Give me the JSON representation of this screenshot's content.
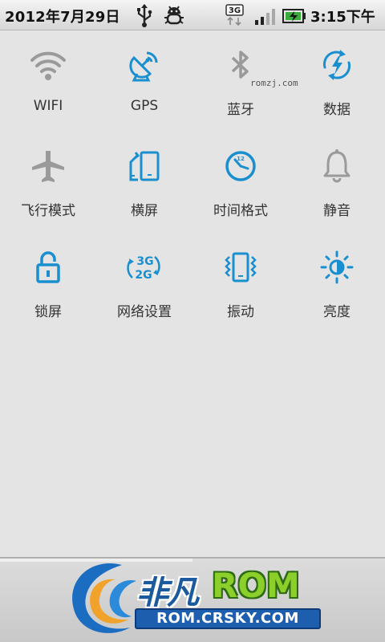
{
  "status_bar": {
    "date": "2012年7月29日",
    "network_type": "3G",
    "time": "3:15下午",
    "icons": [
      "usb-icon",
      "debug-icon",
      "3g-icon",
      "signal-icon",
      "battery-charging-icon"
    ]
  },
  "watermark": "romzj.com",
  "toggles": [
    {
      "label": "WIFI",
      "icon": "wifi-icon",
      "active": false
    },
    {
      "label": "GPS",
      "icon": "gps-icon",
      "active": true
    },
    {
      "label": "蓝牙",
      "icon": "bluetooth-icon",
      "active": false
    },
    {
      "label": "数据",
      "icon": "mobile-data-icon",
      "active": true
    },
    {
      "label": "飞行模式",
      "icon": "airplane-icon",
      "active": false
    },
    {
      "label": "横屏",
      "icon": "rotate-screen-icon",
      "active": true
    },
    {
      "label": "时间格式",
      "icon": "clock-icon",
      "active": true
    },
    {
      "label": "静音",
      "icon": "bell-icon",
      "active": false
    },
    {
      "label": "锁屏",
      "icon": "lock-icon",
      "active": true
    },
    {
      "label": "网络设置",
      "icon": "3g-2g-switch-icon",
      "active": true
    },
    {
      "label": "振动",
      "icon": "vibrate-icon",
      "active": true
    },
    {
      "label": "亮度",
      "icon": "brightness-icon",
      "active": true
    }
  ],
  "logo": {
    "name_cn": "非凡",
    "name_en": "ROM",
    "url": "ROM.CRSKY.COM"
  },
  "colors": {
    "active": "#1a8fcf",
    "inactive": "#9a9a9a",
    "background": "#e4e4e4"
  }
}
